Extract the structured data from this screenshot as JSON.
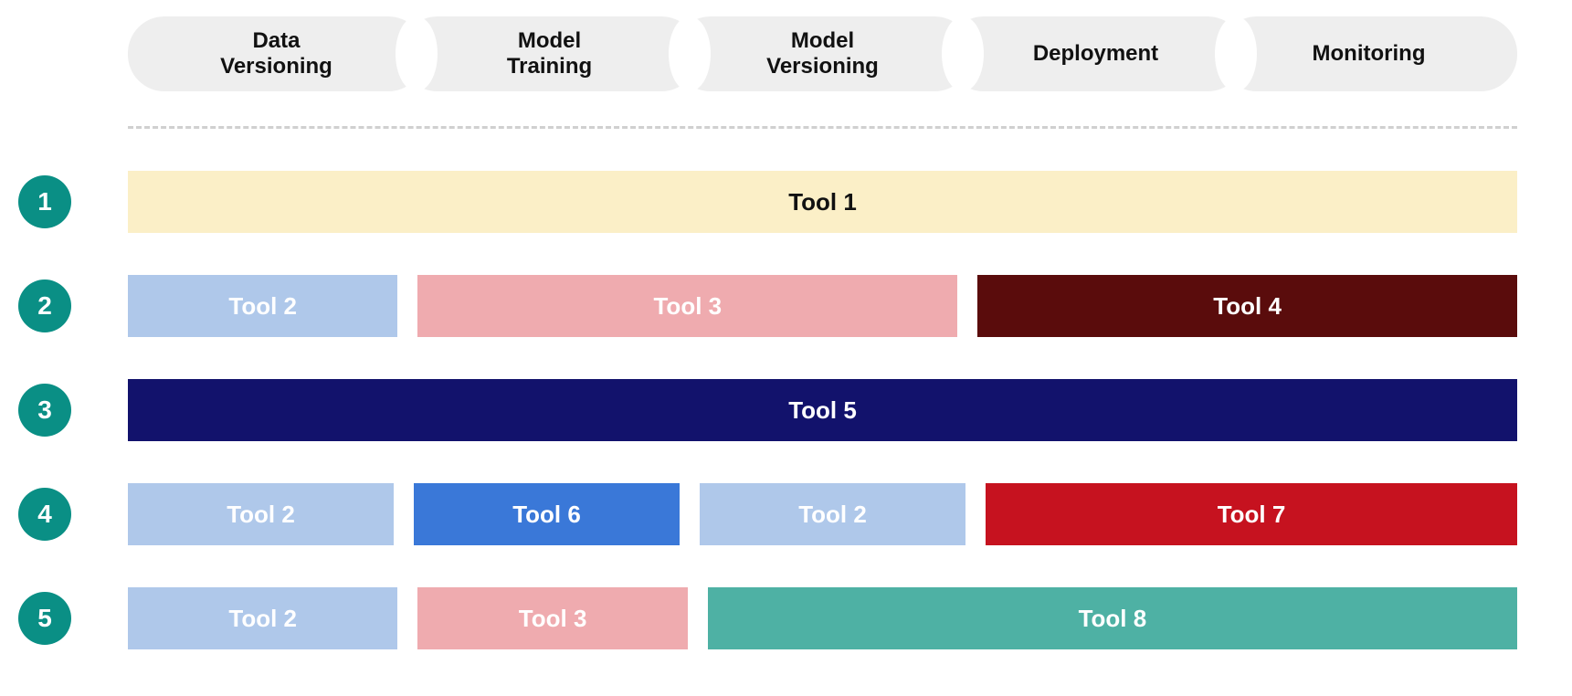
{
  "stages": {
    "s0": "Data Versioning",
    "s1": "Model Training",
    "s2": "Model Versioning",
    "s3": "Deployment",
    "s4": "Monitoring"
  },
  "rows": {
    "r1": {
      "badge": "1"
    },
    "r2": {
      "badge": "2"
    },
    "r3": {
      "badge": "3"
    },
    "r4": {
      "badge": "4"
    },
    "r5": {
      "badge": "5"
    }
  },
  "tools": {
    "t1": "Tool 1",
    "t2": "Tool 2",
    "t3": "Tool 3",
    "t4": "Tool 4",
    "t5": "Tool 5",
    "t6": "Tool 6",
    "t7": "Tool 7",
    "t8": "Tool 8"
  },
  "colors": {
    "cream": "#fbefc7",
    "lightBlue": "#afc8ea",
    "pink": "#efabaf",
    "darkRed": "#5a0c0c",
    "navy": "#12126c",
    "blue": "#3a78d8",
    "red": "#c6121f",
    "teal": "#4eb1a4",
    "badge": "#0a8f85",
    "stageBg": "#eeeeee"
  },
  "chart_data": {
    "type": "table",
    "columns": [
      "Data Versioning",
      "Model Training",
      "Model Versioning",
      "Deployment",
      "Monitoring"
    ],
    "rows": [
      {
        "id": "1",
        "cells": [
          "Tool 1",
          "Tool 1",
          "Tool 1",
          "Tool 1",
          "Tool 1"
        ]
      },
      {
        "id": "2",
        "cells": [
          "Tool 2",
          "Tool 3",
          "Tool 3",
          "Tool 4",
          "Tool 4"
        ]
      },
      {
        "id": "3",
        "cells": [
          "Tool 5",
          "Tool 5",
          "Tool 5",
          "Tool 5",
          "Tool 5"
        ]
      },
      {
        "id": "4",
        "cells": [
          "Tool 2",
          "Tool 6",
          "Tool 2",
          "Tool 7",
          "Tool 7"
        ]
      },
      {
        "id": "5",
        "cells": [
          "Tool 2",
          "Tool 3",
          "Tool 8",
          "Tool 8",
          "Tool 8"
        ]
      }
    ]
  }
}
